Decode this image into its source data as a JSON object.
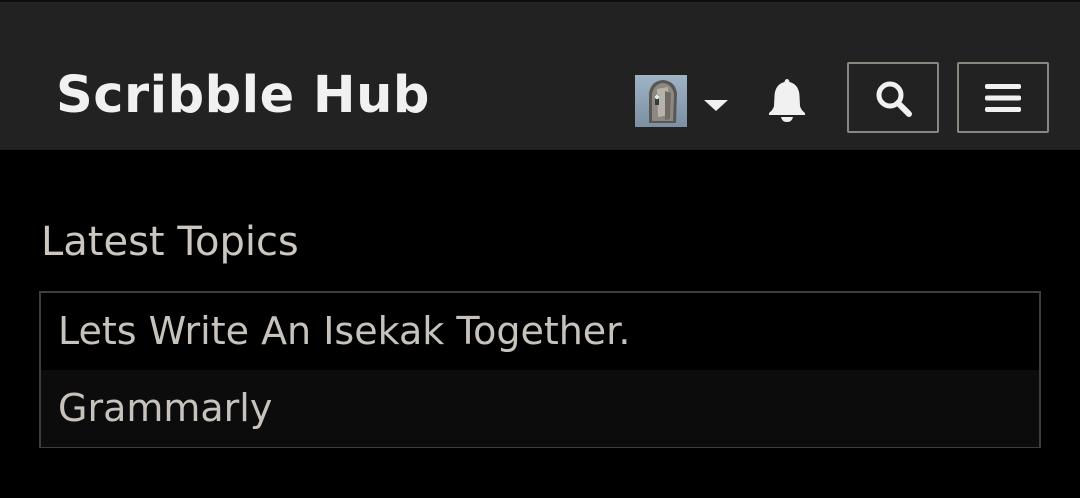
{
  "header": {
    "site_title": "Scribble Hub",
    "icons": {
      "avatar": "user-avatar",
      "caret": "caret-down-icon",
      "notifications": "bell-icon",
      "search": "search-icon",
      "menu": "hamburger-menu-icon"
    }
  },
  "main": {
    "section_title": "Latest Topics",
    "topics": [
      {
        "label": "Lets Write An Isekak Together."
      },
      {
        "label": "Grammarly"
      }
    ]
  },
  "colors": {
    "header_bg": "#222222",
    "page_bg": "#000000",
    "text": "#c7c3bc",
    "brand_text": "#f1f1f1",
    "button_border": "#8a8680"
  }
}
